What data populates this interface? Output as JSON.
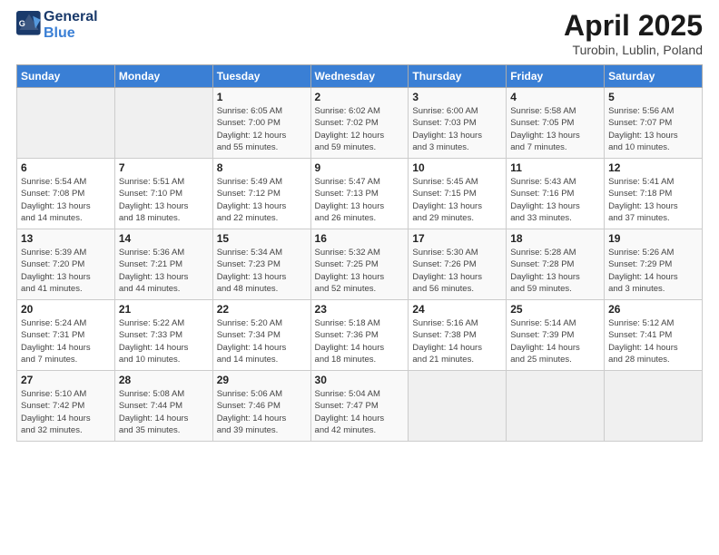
{
  "header": {
    "logo_line1": "General",
    "logo_line2": "Blue",
    "title": "April 2025",
    "subtitle": "Turobin, Lublin, Poland"
  },
  "weekdays": [
    "Sunday",
    "Monday",
    "Tuesday",
    "Wednesday",
    "Thursday",
    "Friday",
    "Saturday"
  ],
  "weeks": [
    [
      {
        "day": "",
        "info": ""
      },
      {
        "day": "",
        "info": ""
      },
      {
        "day": "1",
        "info": "Sunrise: 6:05 AM\nSunset: 7:00 PM\nDaylight: 12 hours\nand 55 minutes."
      },
      {
        "day": "2",
        "info": "Sunrise: 6:02 AM\nSunset: 7:02 PM\nDaylight: 12 hours\nand 59 minutes."
      },
      {
        "day": "3",
        "info": "Sunrise: 6:00 AM\nSunset: 7:03 PM\nDaylight: 13 hours\nand 3 minutes."
      },
      {
        "day": "4",
        "info": "Sunrise: 5:58 AM\nSunset: 7:05 PM\nDaylight: 13 hours\nand 7 minutes."
      },
      {
        "day": "5",
        "info": "Sunrise: 5:56 AM\nSunset: 7:07 PM\nDaylight: 13 hours\nand 10 minutes."
      }
    ],
    [
      {
        "day": "6",
        "info": "Sunrise: 5:54 AM\nSunset: 7:08 PM\nDaylight: 13 hours\nand 14 minutes."
      },
      {
        "day": "7",
        "info": "Sunrise: 5:51 AM\nSunset: 7:10 PM\nDaylight: 13 hours\nand 18 minutes."
      },
      {
        "day": "8",
        "info": "Sunrise: 5:49 AM\nSunset: 7:12 PM\nDaylight: 13 hours\nand 22 minutes."
      },
      {
        "day": "9",
        "info": "Sunrise: 5:47 AM\nSunset: 7:13 PM\nDaylight: 13 hours\nand 26 minutes."
      },
      {
        "day": "10",
        "info": "Sunrise: 5:45 AM\nSunset: 7:15 PM\nDaylight: 13 hours\nand 29 minutes."
      },
      {
        "day": "11",
        "info": "Sunrise: 5:43 AM\nSunset: 7:16 PM\nDaylight: 13 hours\nand 33 minutes."
      },
      {
        "day": "12",
        "info": "Sunrise: 5:41 AM\nSunset: 7:18 PM\nDaylight: 13 hours\nand 37 minutes."
      }
    ],
    [
      {
        "day": "13",
        "info": "Sunrise: 5:39 AM\nSunset: 7:20 PM\nDaylight: 13 hours\nand 41 minutes."
      },
      {
        "day": "14",
        "info": "Sunrise: 5:36 AM\nSunset: 7:21 PM\nDaylight: 13 hours\nand 44 minutes."
      },
      {
        "day": "15",
        "info": "Sunrise: 5:34 AM\nSunset: 7:23 PM\nDaylight: 13 hours\nand 48 minutes."
      },
      {
        "day": "16",
        "info": "Sunrise: 5:32 AM\nSunset: 7:25 PM\nDaylight: 13 hours\nand 52 minutes."
      },
      {
        "day": "17",
        "info": "Sunrise: 5:30 AM\nSunset: 7:26 PM\nDaylight: 13 hours\nand 56 minutes."
      },
      {
        "day": "18",
        "info": "Sunrise: 5:28 AM\nSunset: 7:28 PM\nDaylight: 13 hours\nand 59 minutes."
      },
      {
        "day": "19",
        "info": "Sunrise: 5:26 AM\nSunset: 7:29 PM\nDaylight: 14 hours\nand 3 minutes."
      }
    ],
    [
      {
        "day": "20",
        "info": "Sunrise: 5:24 AM\nSunset: 7:31 PM\nDaylight: 14 hours\nand 7 minutes."
      },
      {
        "day": "21",
        "info": "Sunrise: 5:22 AM\nSunset: 7:33 PM\nDaylight: 14 hours\nand 10 minutes."
      },
      {
        "day": "22",
        "info": "Sunrise: 5:20 AM\nSunset: 7:34 PM\nDaylight: 14 hours\nand 14 minutes."
      },
      {
        "day": "23",
        "info": "Sunrise: 5:18 AM\nSunset: 7:36 PM\nDaylight: 14 hours\nand 18 minutes."
      },
      {
        "day": "24",
        "info": "Sunrise: 5:16 AM\nSunset: 7:38 PM\nDaylight: 14 hours\nand 21 minutes."
      },
      {
        "day": "25",
        "info": "Sunrise: 5:14 AM\nSunset: 7:39 PM\nDaylight: 14 hours\nand 25 minutes."
      },
      {
        "day": "26",
        "info": "Sunrise: 5:12 AM\nSunset: 7:41 PM\nDaylight: 14 hours\nand 28 minutes."
      }
    ],
    [
      {
        "day": "27",
        "info": "Sunrise: 5:10 AM\nSunset: 7:42 PM\nDaylight: 14 hours\nand 32 minutes."
      },
      {
        "day": "28",
        "info": "Sunrise: 5:08 AM\nSunset: 7:44 PM\nDaylight: 14 hours\nand 35 minutes."
      },
      {
        "day": "29",
        "info": "Sunrise: 5:06 AM\nSunset: 7:46 PM\nDaylight: 14 hours\nand 39 minutes."
      },
      {
        "day": "30",
        "info": "Sunrise: 5:04 AM\nSunset: 7:47 PM\nDaylight: 14 hours\nand 42 minutes."
      },
      {
        "day": "",
        "info": ""
      },
      {
        "day": "",
        "info": ""
      },
      {
        "day": "",
        "info": ""
      }
    ]
  ]
}
